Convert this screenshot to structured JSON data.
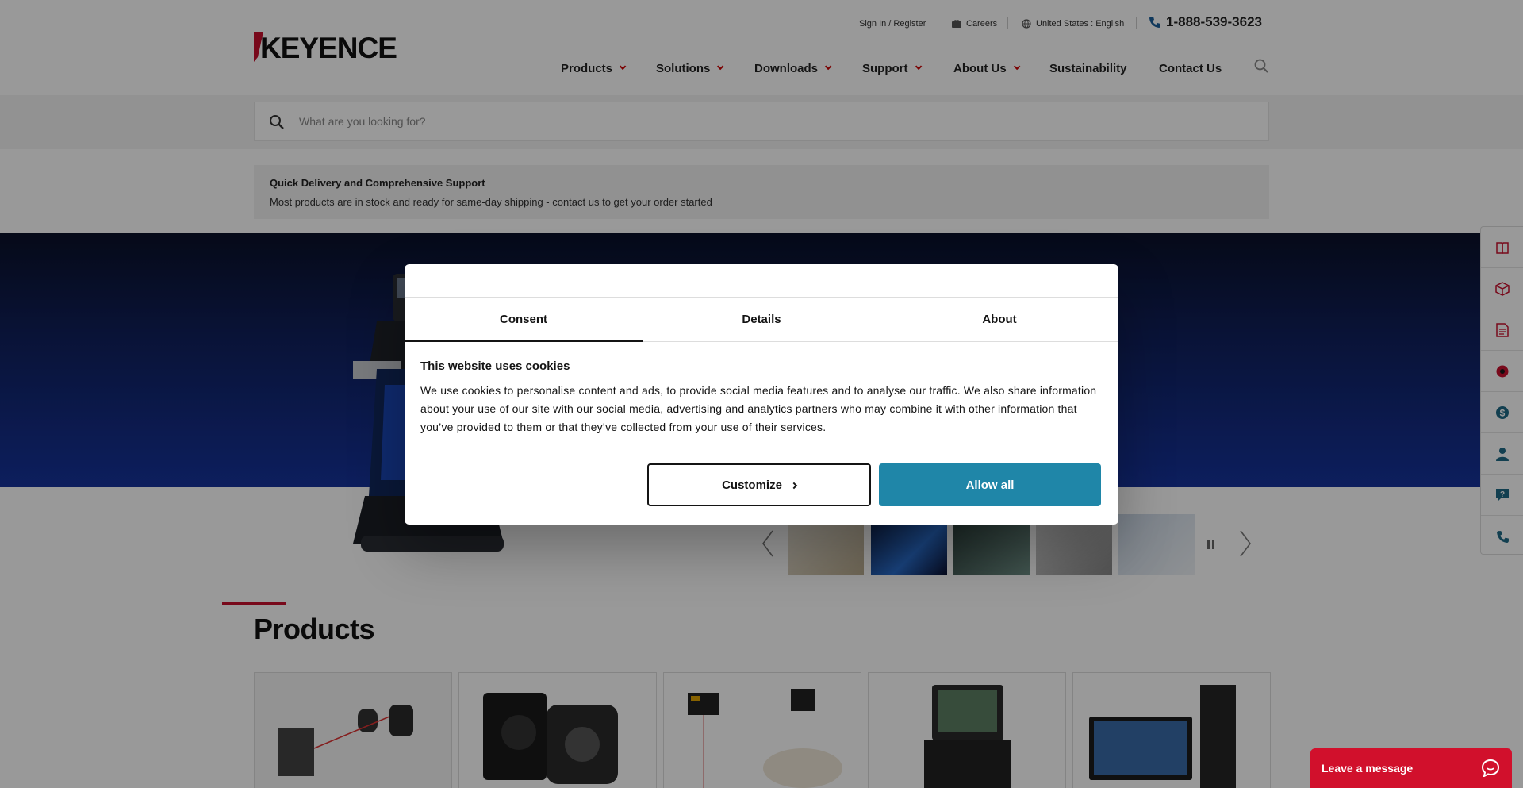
{
  "header": {
    "logo_text": "KEYENCE",
    "utility": {
      "sign_in": "Sign In / Register",
      "careers": "Careers",
      "region": "United States : English",
      "phone": "1-888-539-3623"
    },
    "nav": [
      {
        "label": "Products",
        "has_menu": true
      },
      {
        "label": "Solutions",
        "has_menu": true
      },
      {
        "label": "Downloads",
        "has_menu": true
      },
      {
        "label": "Support",
        "has_menu": true
      },
      {
        "label": "About Us",
        "has_menu": true
      },
      {
        "label": "Sustainability",
        "has_menu": false
      },
      {
        "label": "Contact Us",
        "has_menu": false
      }
    ]
  },
  "search": {
    "placeholder": "What are you looking for?",
    "value": ""
  },
  "notice": {
    "title": "Quick Delivery and Comprehensive Support",
    "text": "Most products are in stock and ready for same-day shipping - contact us to get your order started"
  },
  "products": {
    "title": "Products"
  },
  "side_rail": [
    "catalog-icon",
    "box-icon",
    "document-icon",
    "record-icon",
    "price-icon",
    "person-icon",
    "question-icon",
    "phone-icon"
  ],
  "cookie_dialog": {
    "tabs": [
      {
        "label": "Consent",
        "active": true
      },
      {
        "label": "Details",
        "active": false
      },
      {
        "label": "About",
        "active": false
      }
    ],
    "heading": "This website uses cookies",
    "body": "We use cookies to personalise content and ads, to provide social media features and to analyse our traffic. We also share information about your use of our site with our social media, advertising and analytics partners who may combine it with other information that you’ve provided to them or that they’ve collected from your use of their services.",
    "customize_label": "Customize",
    "allow_label": "Allow all"
  },
  "chat": {
    "label": "Leave a message"
  },
  "colors": {
    "brand_red": "#c8102e",
    "allow_button": "#1f86a8",
    "chat_red": "#d1102c"
  }
}
